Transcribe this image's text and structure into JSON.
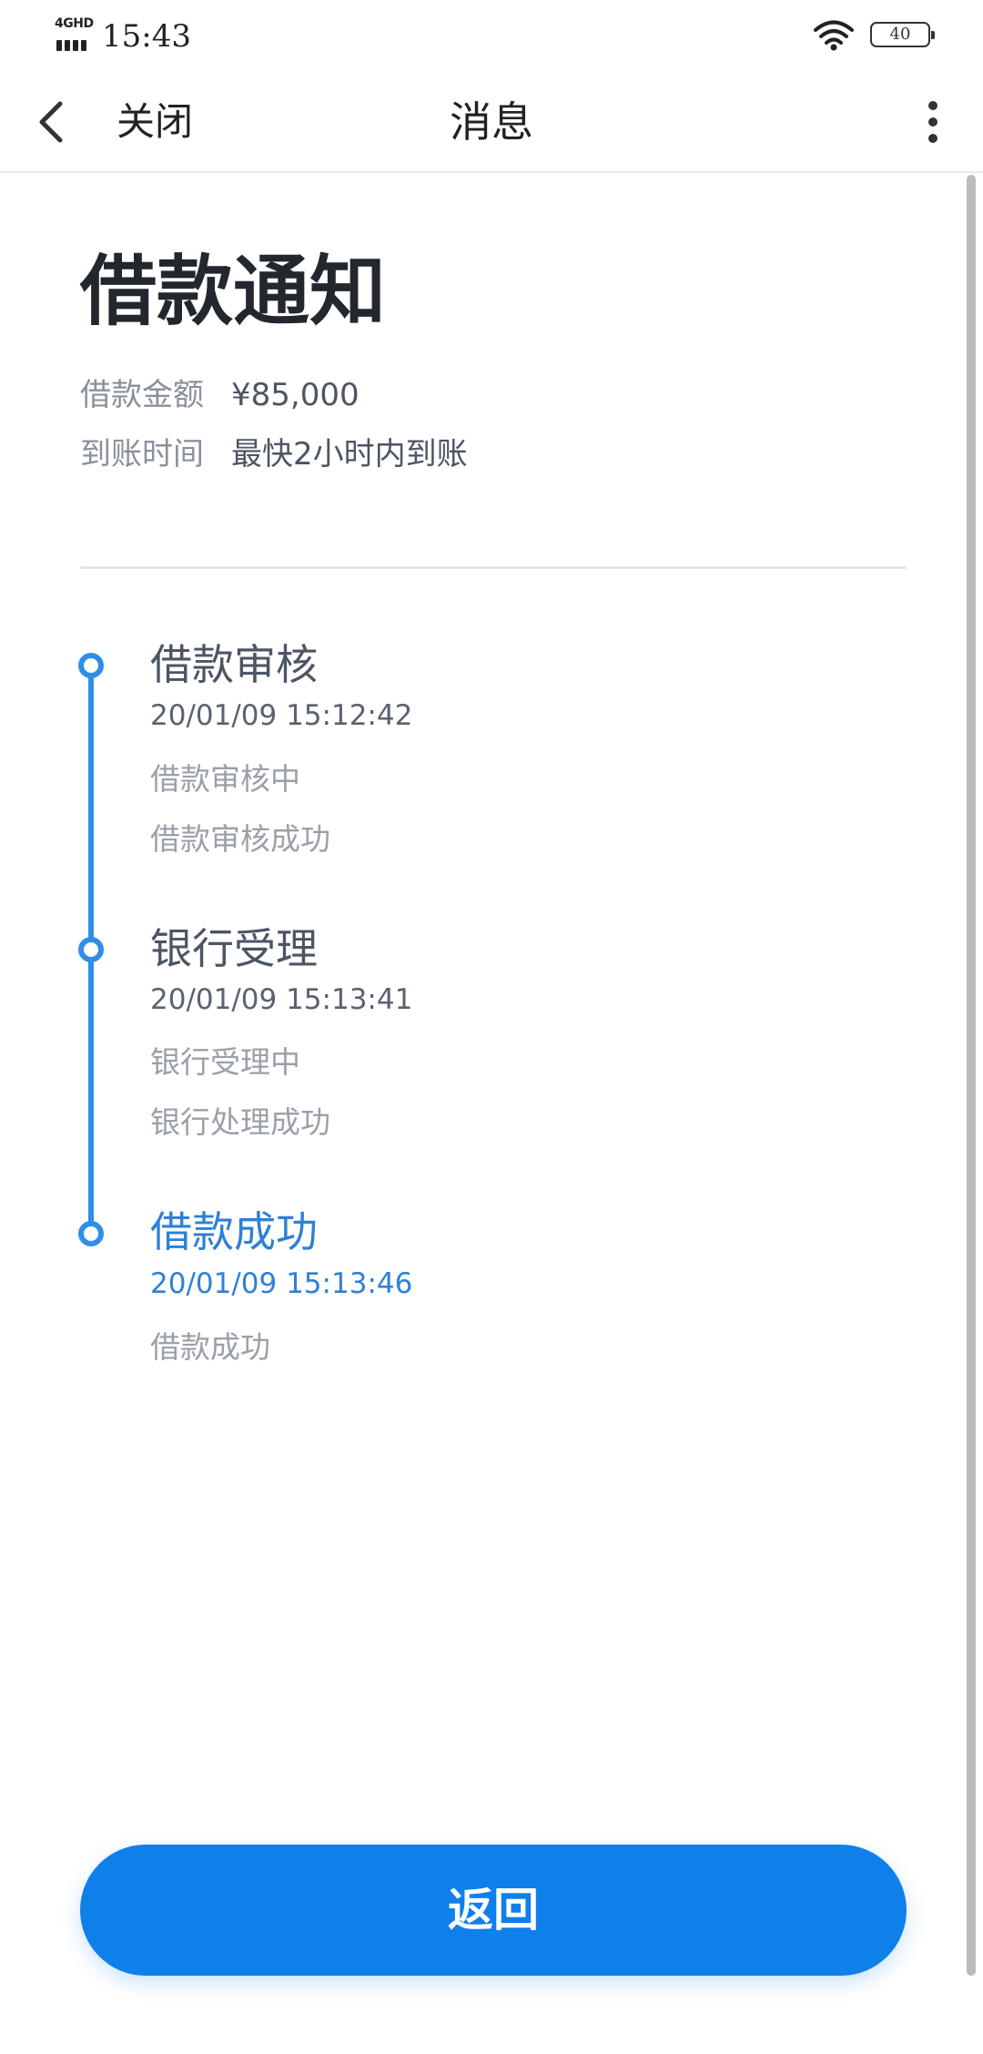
{
  "status_bar": {
    "network": "4GHD",
    "time": "15:43",
    "battery": "40"
  },
  "nav": {
    "close_label": "关闭",
    "title": "消息"
  },
  "page": {
    "title": "借款通知",
    "info": [
      {
        "label": "借款金额",
        "value": "¥85,000"
      },
      {
        "label": "到账时间",
        "value": "最快2小时内到账"
      }
    ]
  },
  "timeline": [
    {
      "title": "借款审核",
      "time": "20/01/09 15:12:42",
      "details": [
        "借款审核中",
        "借款审核成功"
      ]
    },
    {
      "title": "银行受理",
      "time": "20/01/09 15:13:41",
      "details": [
        "银行受理中",
        "银行处理成功"
      ]
    },
    {
      "title": "借款成功",
      "time": "20/01/09 15:13:46",
      "details": [
        "借款成功"
      ]
    }
  ],
  "colors": {
    "accent": "#0f7fea",
    "timeline": "#2f8ee8",
    "active_text": "#2f80d6"
  },
  "actions": {
    "return_label": "返回"
  }
}
